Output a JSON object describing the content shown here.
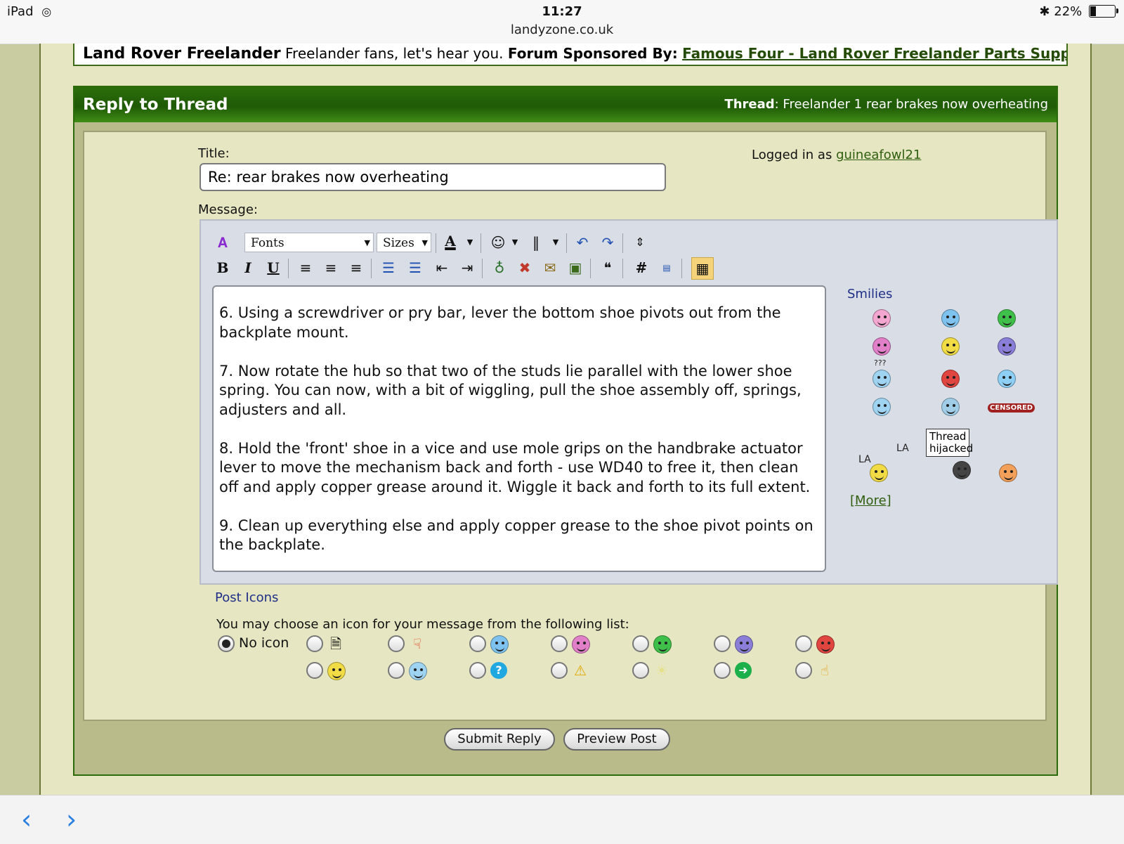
{
  "status_bar": {
    "device": "iPad",
    "time": "11:27",
    "url": "landyzone.co.uk",
    "battery": "22%",
    "battery_level": 0.22
  },
  "forum": {
    "name": "Land Rover Freelander",
    "tagline": "Freelander fans, let's hear you.",
    "sponsor_label": "Forum Sponsored By:",
    "sponsor_link": "Famous Four - Land Rover Freelander Parts Supplier"
  },
  "reply": {
    "header": "Reply to Thread",
    "thread_label": "Thread",
    "thread_title": ": Freelander 1 rear brakes now overheating",
    "title_label": "Title:",
    "title_value": "Re: rear brakes now overheating",
    "logged_in_prefix": "Logged in as",
    "username": "guineafowl21",
    "message_label": "Message:"
  },
  "editor": {
    "font_select": "Fonts",
    "size_select": "Sizes",
    "message": "6. Using a screwdriver or pry bar, lever the bottom shoe pivots out from the\nbackplate mount.\n\n7. Now rotate the hub so that two of the studs lie parallel with the lower shoe\nspring. You can now, with a bit of wiggling, pull the shoe assembly off, springs,\nadjusters and all.\n\n8. Hold the 'front' shoe in a vice and use mole grips on the handbrake actuator\nlever to move the mechanism back and forth - use WD40 to free it, then clean\noff and apply copper grease around it. Wiggle it back and forth to its full extent.\n\n9. Clean up everything else and apply copper grease to the shoe pivot points on\nthe backplate."
  },
  "smilies": {
    "title": "Smilies",
    "question_marks": "???",
    "censored": "CENSORED",
    "sign": "Thread hijacked",
    "la_1": "LA",
    "la_2": "LA",
    "more": "[More]"
  },
  "post_icons": {
    "title": "Post Icons",
    "description": "You may choose an icon for your message from the following list:",
    "no_icon_label": "No icon"
  },
  "buttons": {
    "submit": "Submit Reply",
    "preview": "Preview Post"
  },
  "colors": {
    "header_green": "#2c6e0b",
    "page_bg": "#e6e7c2",
    "link_green": "#2f5e0e",
    "editor_bg": "#d9dde5"
  }
}
